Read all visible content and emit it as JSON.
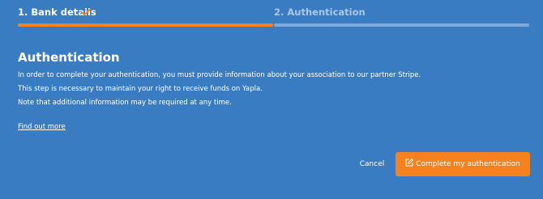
{
  "stepper": {
    "steps": [
      {
        "label": "1. Bank details",
        "status": "completed",
        "icon": "check-icon"
      },
      {
        "label": "2. Authentication",
        "status": "active"
      }
    ]
  },
  "section": {
    "title": "Authentication",
    "paragraphs": [
      "In order to complete your authentication, you must provide information about your association to our partner Stripe.",
      "This step is necessary to maintain your right to receive funds on Yapla.",
      "Note that additional information may be required at any time."
    ],
    "link_label": "Find out more"
  },
  "actions": {
    "cancel_label": "Cancel",
    "primary_label": "Complete my authentication",
    "primary_icon": "edit-icon"
  },
  "colors": {
    "background": "#3a7cc1",
    "accent": "#f6821f",
    "inactive_step": "#7fa9d8"
  }
}
